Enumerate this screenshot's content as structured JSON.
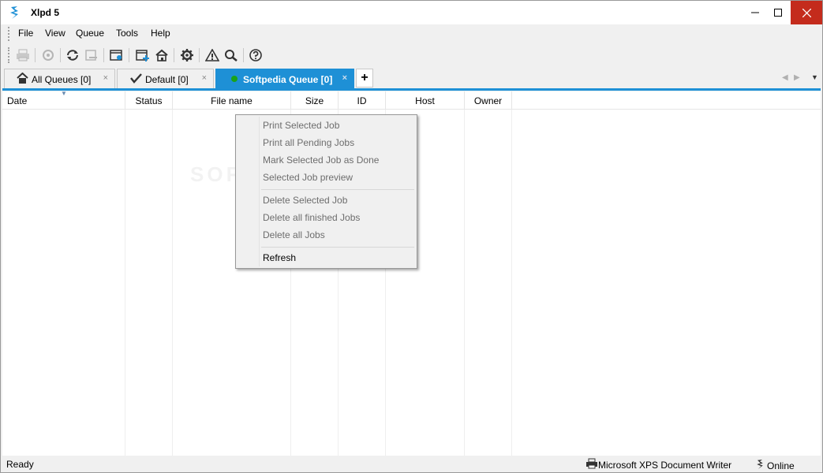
{
  "window": {
    "title": "Xlpd 5"
  },
  "menu": [
    "File",
    "View",
    "Queue",
    "Tools",
    "Help"
  ],
  "toolbar": {
    "icons": [
      "print-icon",
      "cancel-print-icon",
      "refresh-icon",
      "remove-icon",
      "queue-settings-icon",
      "add-queue-icon",
      "home-icon",
      "gear-icon",
      "alert-icon",
      "search-icon",
      "help-icon"
    ]
  },
  "tabs": [
    {
      "label": "All Queues [0]",
      "icon": "home-icon",
      "active": false
    },
    {
      "label": "Default [0]",
      "icon": "checkmark-icon",
      "active": false
    },
    {
      "label": "Softpedia Queue [0]",
      "icon": "green-dot-icon",
      "active": true
    }
  ],
  "tab_close_glyph": "×",
  "tab_add_glyph": "+",
  "columns": [
    "Date",
    "Status",
    "File name",
    "Size",
    "ID",
    "Host",
    "Owner"
  ],
  "watermark": "SOFTPEDIA",
  "context_menu": {
    "group1": [
      "Print Selected Job",
      "Print all Pending Jobs",
      "Mark Selected Job as Done",
      "Selected Job preview"
    ],
    "group2": [
      "Delete Selected Job",
      "Delete all finished Jobs",
      "Delete all Jobs"
    ],
    "group3": [
      "Refresh"
    ]
  },
  "status": {
    "left": "Ready",
    "printer": "Microsoft XPS Document Writer",
    "connection": "Online"
  },
  "colors": {
    "accent": "#1e90d6",
    "close": "#c42b1c",
    "online_dot": "#1aa31a"
  }
}
